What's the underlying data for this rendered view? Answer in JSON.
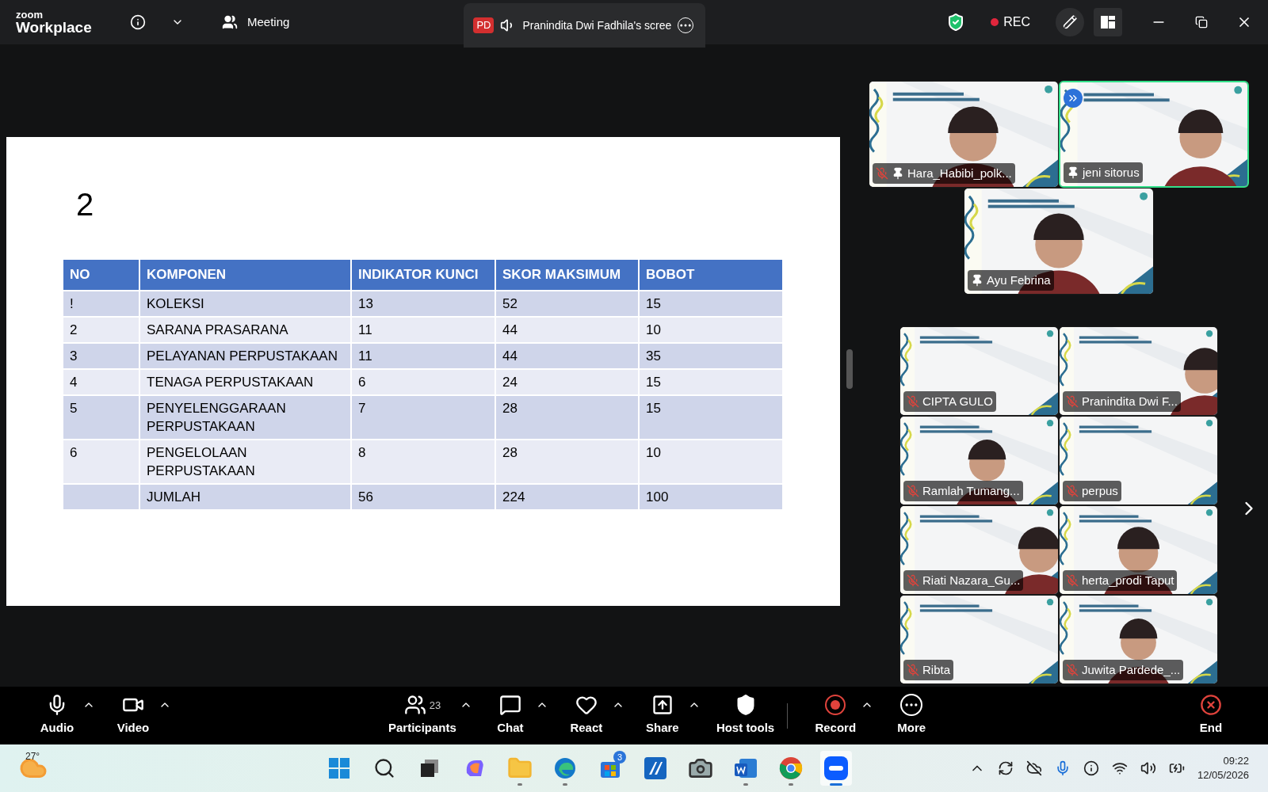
{
  "top_bar": {
    "logo_small": "zoom",
    "logo": "Workplace",
    "meeting": "Meeting",
    "share_tab": {
      "badge": "PD",
      "title": "Pranindita Dwi Fadhila's scree"
    },
    "rec": "REC"
  },
  "slide": {
    "title": "2",
    "table": {
      "columns": [
        "NO",
        "KOMPONEN",
        "INDIKATOR KUNCI",
        "SKOR MAKSIMUM",
        "BOBOT"
      ],
      "rows": [
        [
          "!",
          "KOLEKSI",
          "13",
          "52",
          "15"
        ],
        [
          "2",
          "SARANA PRASARANA",
          "11",
          "44",
          "10"
        ],
        [
          "3",
          "PELAYANAN PERPUSTAKAAN",
          "11",
          "44",
          "35"
        ],
        [
          "4",
          "TENAGA PERPUSTAKAAN",
          "6",
          "24",
          "15"
        ],
        [
          "5",
          "PENYELENGGARAAN PERPUSTAKAAN",
          "7",
          "28",
          "15"
        ],
        [
          "6",
          "PENGELOLAAN PERPUSTAKAAN",
          "8",
          "28",
          "10"
        ],
        [
          "",
          "JUMLAH",
          "56",
          "224",
          "100"
        ]
      ]
    }
  },
  "pinned_videos": [
    {
      "name": "Hara_Habibi_polk...",
      "muted": true,
      "pinned": true,
      "speaking": false
    },
    {
      "name": "jeni sitorus",
      "muted": false,
      "pinned": true,
      "speaking": true
    },
    {
      "name": "Ayu Febrina",
      "muted": false,
      "pinned": true,
      "speaking": false
    }
  ],
  "gallery": [
    {
      "name": "CIPTA GULO",
      "muted": true
    },
    {
      "name": "Pranindita Dwi F...",
      "muted": true
    },
    {
      "name": "Ramlah Tumang...",
      "muted": true
    },
    {
      "name": "perpus",
      "muted": true
    },
    {
      "name": "Riati Nazara_Gu...",
      "muted": true
    },
    {
      "name": "herta_prodi Taput",
      "muted": true
    },
    {
      "name": "Ribta",
      "muted": true
    },
    {
      "name": "Juwita Pardede_...",
      "muted": true
    }
  ],
  "toolbar": [
    {
      "kind": "audio",
      "label": "Audio",
      "caret": true
    },
    {
      "kind": "video",
      "label": "Video",
      "caret": true
    },
    {
      "kind": "participants",
      "label": "Participants",
      "count": "23",
      "caret": true
    },
    {
      "kind": "chat",
      "label": "Chat",
      "caret": true
    },
    {
      "kind": "react",
      "label": "React",
      "caret": true
    },
    {
      "kind": "share",
      "label": "Share",
      "caret": true
    },
    {
      "kind": "host",
      "label": "Host tools",
      "caret": false
    },
    {
      "kind": "record",
      "label": "Record",
      "caret": true
    },
    {
      "kind": "more",
      "label": "More",
      "caret": false
    },
    {
      "kind": "end",
      "label": "End",
      "caret": false
    }
  ],
  "taskbar": {
    "weather": "27°",
    "apps": [
      {
        "kind": "start",
        "running": false,
        "selected": false
      },
      {
        "kind": "search",
        "running": false,
        "selected": false
      },
      {
        "kind": "taskview",
        "running": false,
        "selected": false
      },
      {
        "kind": "copilot",
        "running": false,
        "selected": false
      },
      {
        "kind": "files",
        "running": true,
        "selected": false
      },
      {
        "kind": "edge",
        "running": true,
        "selected": false
      },
      {
        "kind": "store",
        "running": false,
        "selected": false,
        "badge": "3"
      },
      {
        "kind": "app",
        "running": false,
        "selected": false
      },
      {
        "kind": "camera",
        "running": false,
        "selected": false
      },
      {
        "kind": "word",
        "running": true,
        "selected": false
      },
      {
        "kind": "chrome",
        "running": true,
        "selected": false
      },
      {
        "kind": "zoom",
        "running": true,
        "selected": true
      }
    ],
    "time": "09:22",
    "date": "12/05/2026"
  }
}
